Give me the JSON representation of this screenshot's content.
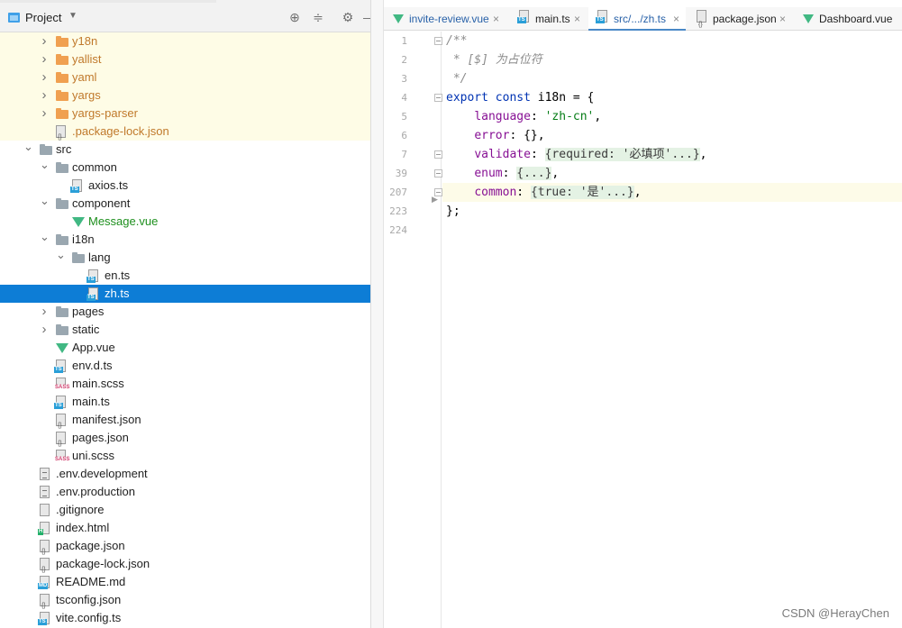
{
  "project_panel": {
    "title": "Project",
    "tree": [
      {
        "label": "y18n",
        "type": "folder-orange",
        "depth": 3,
        "collapsed": true,
        "style": "orange",
        "highlight": true
      },
      {
        "label": "yallist",
        "type": "folder-orange",
        "depth": 3,
        "collapsed": true,
        "style": "orange",
        "highlight": true
      },
      {
        "label": "yaml",
        "type": "folder-orange",
        "depth": 3,
        "collapsed": true,
        "style": "orange",
        "highlight": true
      },
      {
        "label": "yargs",
        "type": "folder-orange",
        "depth": 3,
        "collapsed": true,
        "style": "orange",
        "highlight": true
      },
      {
        "label": "yargs-parser",
        "type": "folder-orange",
        "depth": 3,
        "collapsed": true,
        "style": "orange",
        "highlight": true
      },
      {
        "label": ".package-lock.json",
        "type": "json",
        "depth": 3,
        "style": "orange",
        "highlight": true
      },
      {
        "label": "src",
        "type": "folder",
        "depth": 2,
        "collapsed": false
      },
      {
        "label": "common",
        "type": "folder",
        "depth": 3,
        "collapsed": false
      },
      {
        "label": "axios.ts",
        "type": "ts",
        "depth": 4
      },
      {
        "label": "component",
        "type": "folder",
        "depth": 3,
        "collapsed": false
      },
      {
        "label": "Message.vue",
        "type": "vue",
        "depth": 4,
        "style": "green"
      },
      {
        "label": "i18n",
        "type": "folder",
        "depth": 3,
        "collapsed": false
      },
      {
        "label": "lang",
        "type": "folder",
        "depth": 4,
        "collapsed": false
      },
      {
        "label": "en.ts",
        "type": "ts",
        "depth": 5
      },
      {
        "label": "zh.ts",
        "type": "ts",
        "depth": 5,
        "selected": true
      },
      {
        "label": "pages",
        "type": "folder",
        "depth": 3,
        "collapsed": true
      },
      {
        "label": "static",
        "type": "folder",
        "depth": 3,
        "collapsed": true
      },
      {
        "label": "App.vue",
        "type": "vue",
        "depth": 3
      },
      {
        "label": "env.d.ts",
        "type": "ts",
        "depth": 3
      },
      {
        "label": "main.scss",
        "type": "sass",
        "depth": 3
      },
      {
        "label": "main.ts",
        "type": "ts",
        "depth": 3
      },
      {
        "label": "manifest.json",
        "type": "json",
        "depth": 3
      },
      {
        "label": "pages.json",
        "type": "json",
        "depth": 3
      },
      {
        "label": "uni.scss",
        "type": "sass",
        "depth": 3
      },
      {
        "label": ".env.development",
        "type": "txt",
        "depth": 2
      },
      {
        "label": ".env.production",
        "type": "txt",
        "depth": 2
      },
      {
        "label": ".gitignore",
        "type": "git",
        "depth": 2
      },
      {
        "label": "index.html",
        "type": "html",
        "depth": 2
      },
      {
        "label": "package.json",
        "type": "json",
        "depth": 2
      },
      {
        "label": "package-lock.json",
        "type": "json",
        "depth": 2
      },
      {
        "label": "README.md",
        "type": "md",
        "depth": 2
      },
      {
        "label": "tsconfig.json",
        "type": "json",
        "depth": 2
      },
      {
        "label": "vite.config.ts",
        "type": "ts",
        "depth": 2
      }
    ]
  },
  "tabs": [
    {
      "label": "invite-review.vue",
      "icon": "vue-icon",
      "active": false
    },
    {
      "label": "main.ts",
      "icon": "ts-file-icon",
      "active": false
    },
    {
      "label": "src/.../zh.ts",
      "icon": "ts-file-icon",
      "active": true
    },
    {
      "label": "package.json",
      "icon": "json-file-icon",
      "active": false
    },
    {
      "label": "Dashboard.vue",
      "icon": "vue-icon",
      "active": false
    }
  ],
  "editor": {
    "line_numbers": [
      "1",
      "2",
      "3",
      "4",
      "5",
      "6",
      "7",
      "39",
      "207",
      "223",
      "224"
    ],
    "lines": [
      [
        {
          "t": "/**",
          "c": "comment"
        }
      ],
      [
        {
          "t": " * [$] 为占位符",
          "c": "comment"
        }
      ],
      [
        {
          "t": " */",
          "c": "comment"
        }
      ],
      [
        {
          "t": "export const ",
          "c": "kw"
        },
        {
          "t": "i18n",
          "c": "var"
        },
        {
          "t": " = {",
          "c": "var"
        }
      ],
      [
        {
          "t": "    ",
          "c": "var"
        },
        {
          "t": "language",
          "c": "prop"
        },
        {
          "t": ": ",
          "c": "var"
        },
        {
          "t": "'zh-cn'",
          "c": "str"
        },
        {
          "t": ",",
          "c": "var"
        }
      ],
      [
        {
          "t": "    ",
          "c": "var"
        },
        {
          "t": "error",
          "c": "prop"
        },
        {
          "t": ": {},",
          "c": "var"
        }
      ],
      [
        {
          "t": "    ",
          "c": "var"
        },
        {
          "t": "validate",
          "c": "prop"
        },
        {
          "t": ": ",
          "c": "var"
        },
        {
          "t": "{required: '必填项'...}",
          "c": "fold"
        },
        {
          "t": ",",
          "c": "var"
        }
      ],
      [
        {
          "t": "    ",
          "c": "var"
        },
        {
          "t": "enum",
          "c": "prop"
        },
        {
          "t": ": ",
          "c": "var"
        },
        {
          "t": "{...}",
          "c": "fold"
        },
        {
          "t": ",",
          "c": "var"
        }
      ],
      [
        {
          "t": "    ",
          "c": "var"
        },
        {
          "t": "common",
          "c": "prop"
        },
        {
          "t": ": ",
          "c": "var"
        },
        {
          "t": "{true: '是'...}",
          "c": "fold"
        },
        {
          "t": ",",
          "c": "var"
        }
      ],
      [
        {
          "t": "};",
          "c": "var"
        }
      ],
      [
        {
          "t": "",
          "c": "var"
        }
      ]
    ],
    "current_line_index": 8
  },
  "watermark": "CSDN @HerayChen",
  "colors": {
    "selection": "#0d7dd6",
    "highlight_row": "#fefce6",
    "keyword": "#0033b3",
    "property": "#871094",
    "string": "#067d17",
    "comment": "#8c8c8c"
  }
}
